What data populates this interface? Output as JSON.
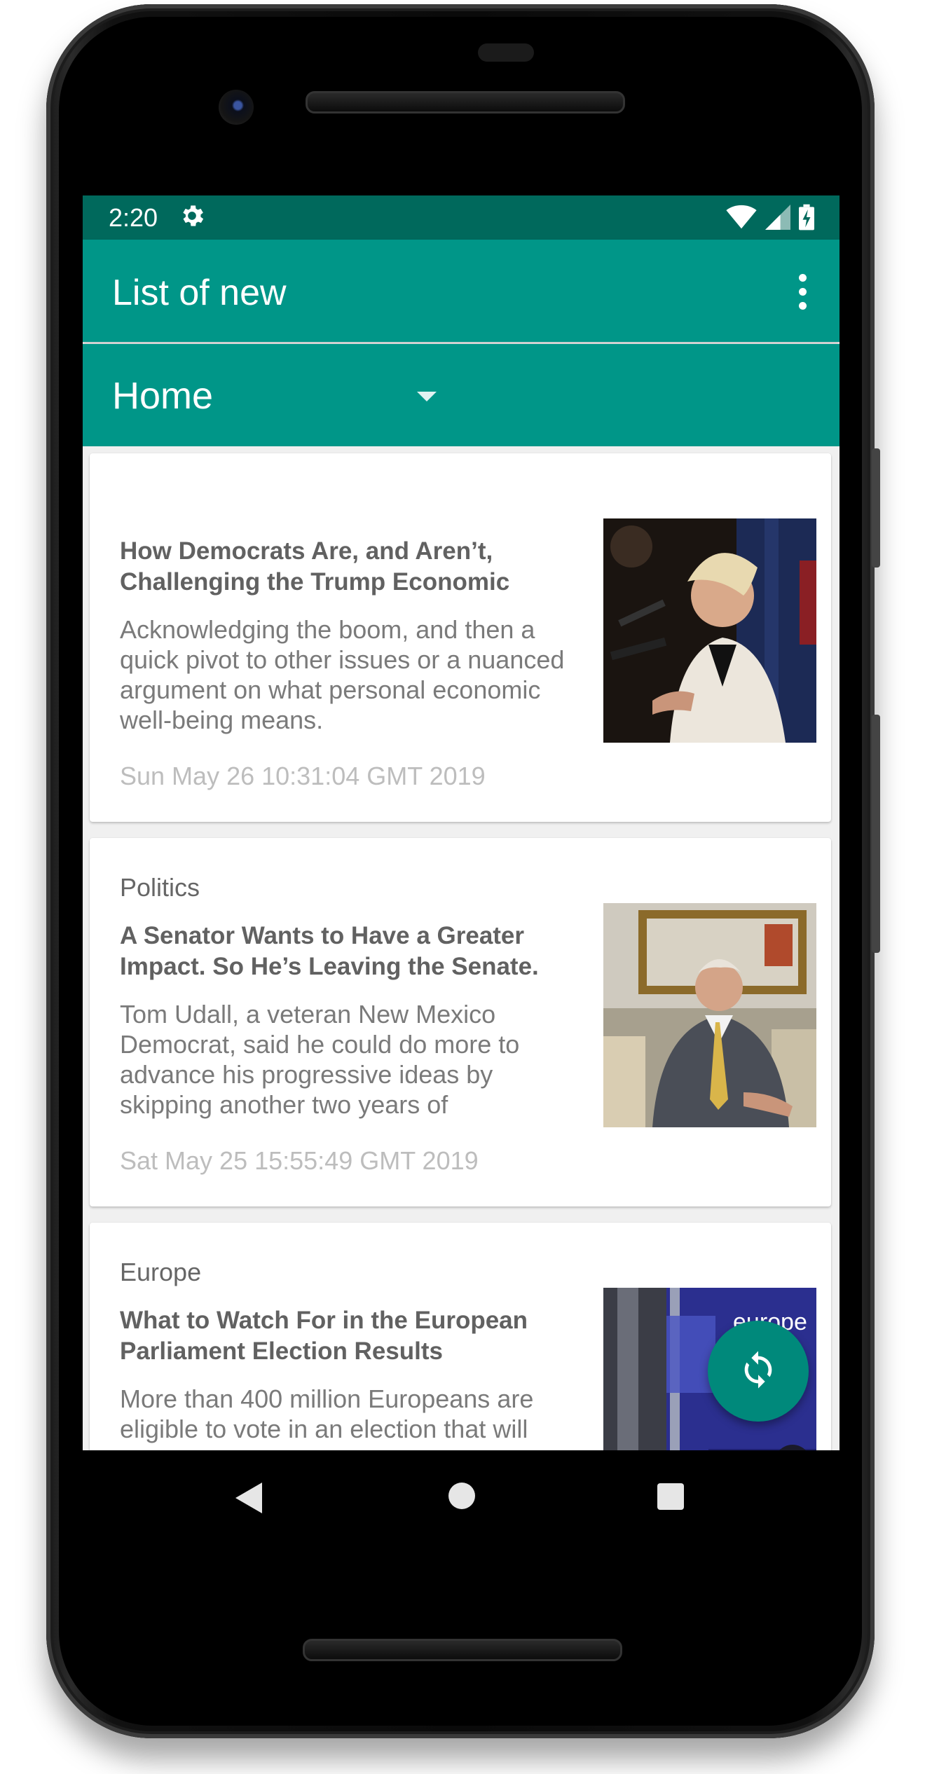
{
  "status_bar": {
    "time": "2:20",
    "icons": [
      "gear-icon",
      "wifi-icon",
      "cell-signal-icon",
      "battery-charging-icon"
    ]
  },
  "app_bar": {
    "title": "List of new",
    "overflow_icon": "more-vert-icon"
  },
  "section_spinner": {
    "selected": "Home"
  },
  "articles": [
    {
      "section": "",
      "title": "How Democrats Are, and Aren’t, Challenging the Trump Economic",
      "description": "Acknowledging the boom, and then a quick pivot to other issues or a nuanced argument on what personal economic well-being means.",
      "date": "Sun May 26 10:31:04 GMT 2019"
    },
    {
      "section": "Politics",
      "title": "A Senator Wants to Have a Greater Impact. So He’s Leaving the Senate.",
      "description": "Tom Udall, a veteran New Mexico Democrat, said he could do more to advance his progressive ideas by skipping another two years of",
      "date": "Sat May 25 15:55:49 GMT 2019"
    },
    {
      "section": "Europe",
      "title": "What to Watch For in the European Parliament Election Results",
      "description": "More than 400 million Europeans are eligible to vote in an election that will",
      "date": "",
      "thumbnail_text": "europe"
    }
  ],
  "fab": {
    "icon": "refresh-icon"
  },
  "nav_bar": {
    "icons": [
      "back-icon",
      "home-icon",
      "recents-icon"
    ]
  },
  "colors": {
    "primary": "#009688",
    "primary_dark": "#00695c",
    "accent": "#00897b"
  }
}
